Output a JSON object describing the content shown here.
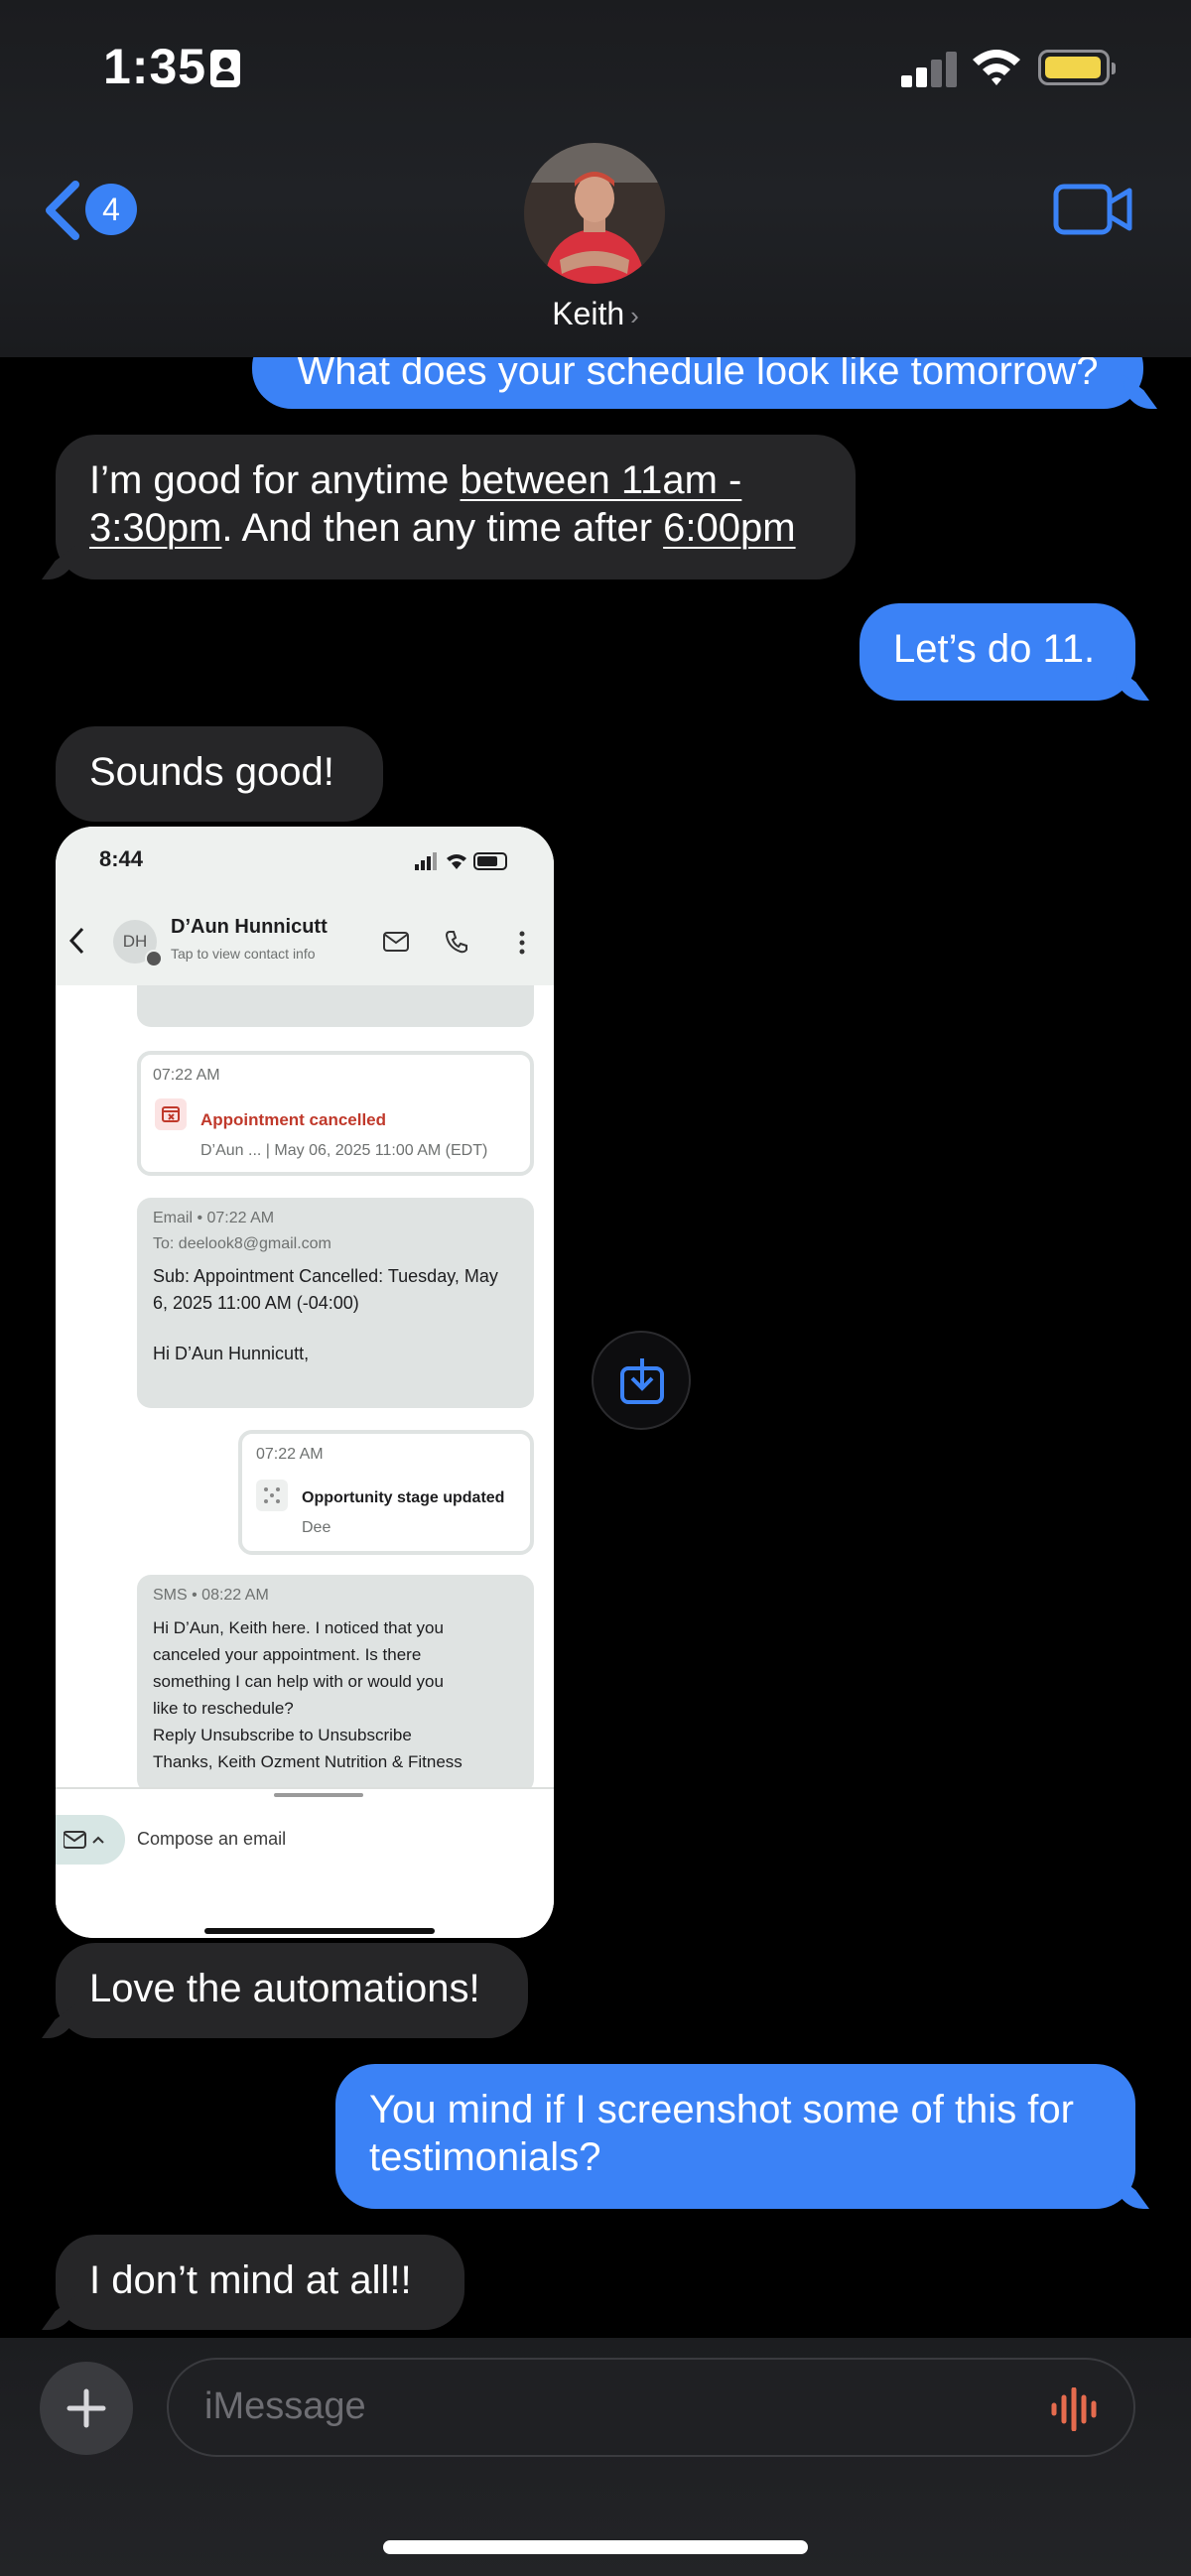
{
  "status_bar": {
    "time": "1:35"
  },
  "header": {
    "back_count": "4",
    "contact_name": "Keith"
  },
  "messages": {
    "m0": "What does your schedule look like tomorrow?",
    "m1_a": "I’m good for anytime ",
    "m1_b": "between 11am -",
    "m1_c": "3:30pm",
    "m1_d": ". And then any time after ",
    "m1_e": "6:00pm",
    "m2": "Let’s do 11.",
    "m3": "Sounds good!",
    "m4": "Love the automations!",
    "m5": "You mind if I screenshot some of this for testimonials?",
    "m6": "I don’t mind at all!!"
  },
  "screenshot": {
    "time": "8:44",
    "contact_initials": "DH",
    "contact_name": "D’Aun Hunnicutt",
    "contact_sub": "Tap to view contact info",
    "appt": {
      "time": "07:22 AM",
      "title": "Appointment cancelled",
      "detail": "D’Aun ...  | May 06, 2025 11:00 AM (EDT)"
    },
    "email": {
      "meta": "Email • 07:22 AM",
      "to": "To: deelook8@gmail.com",
      "subject": "Sub: Appointment Cancelled: Tuesday, May 6, 2025 11:00 AM (-04:00)",
      "greeting": "Hi D’Aun Hunnicutt,"
    },
    "opp": {
      "time": "07:22 AM",
      "title": "Opportunity stage updated",
      "by": "Dee"
    },
    "sms": {
      "meta": "SMS • 08:22 AM",
      "l1": "Hi D’Aun, Keith here. I noticed that you",
      "l2": "canceled your appointment. Is there",
      "l3": "something I can help with or would you",
      "l4": "like to reschedule?",
      "l5": "Reply Unsubscribe to Unsubscribe",
      "l6": "Thanks, Keith Ozment Nutrition & Fitness"
    },
    "compose": "Compose an email"
  },
  "input": {
    "placeholder": "iMessage"
  },
  "colors": {
    "sent": "#3b82f6",
    "received": "#262628",
    "mic": "#e56b4e"
  }
}
